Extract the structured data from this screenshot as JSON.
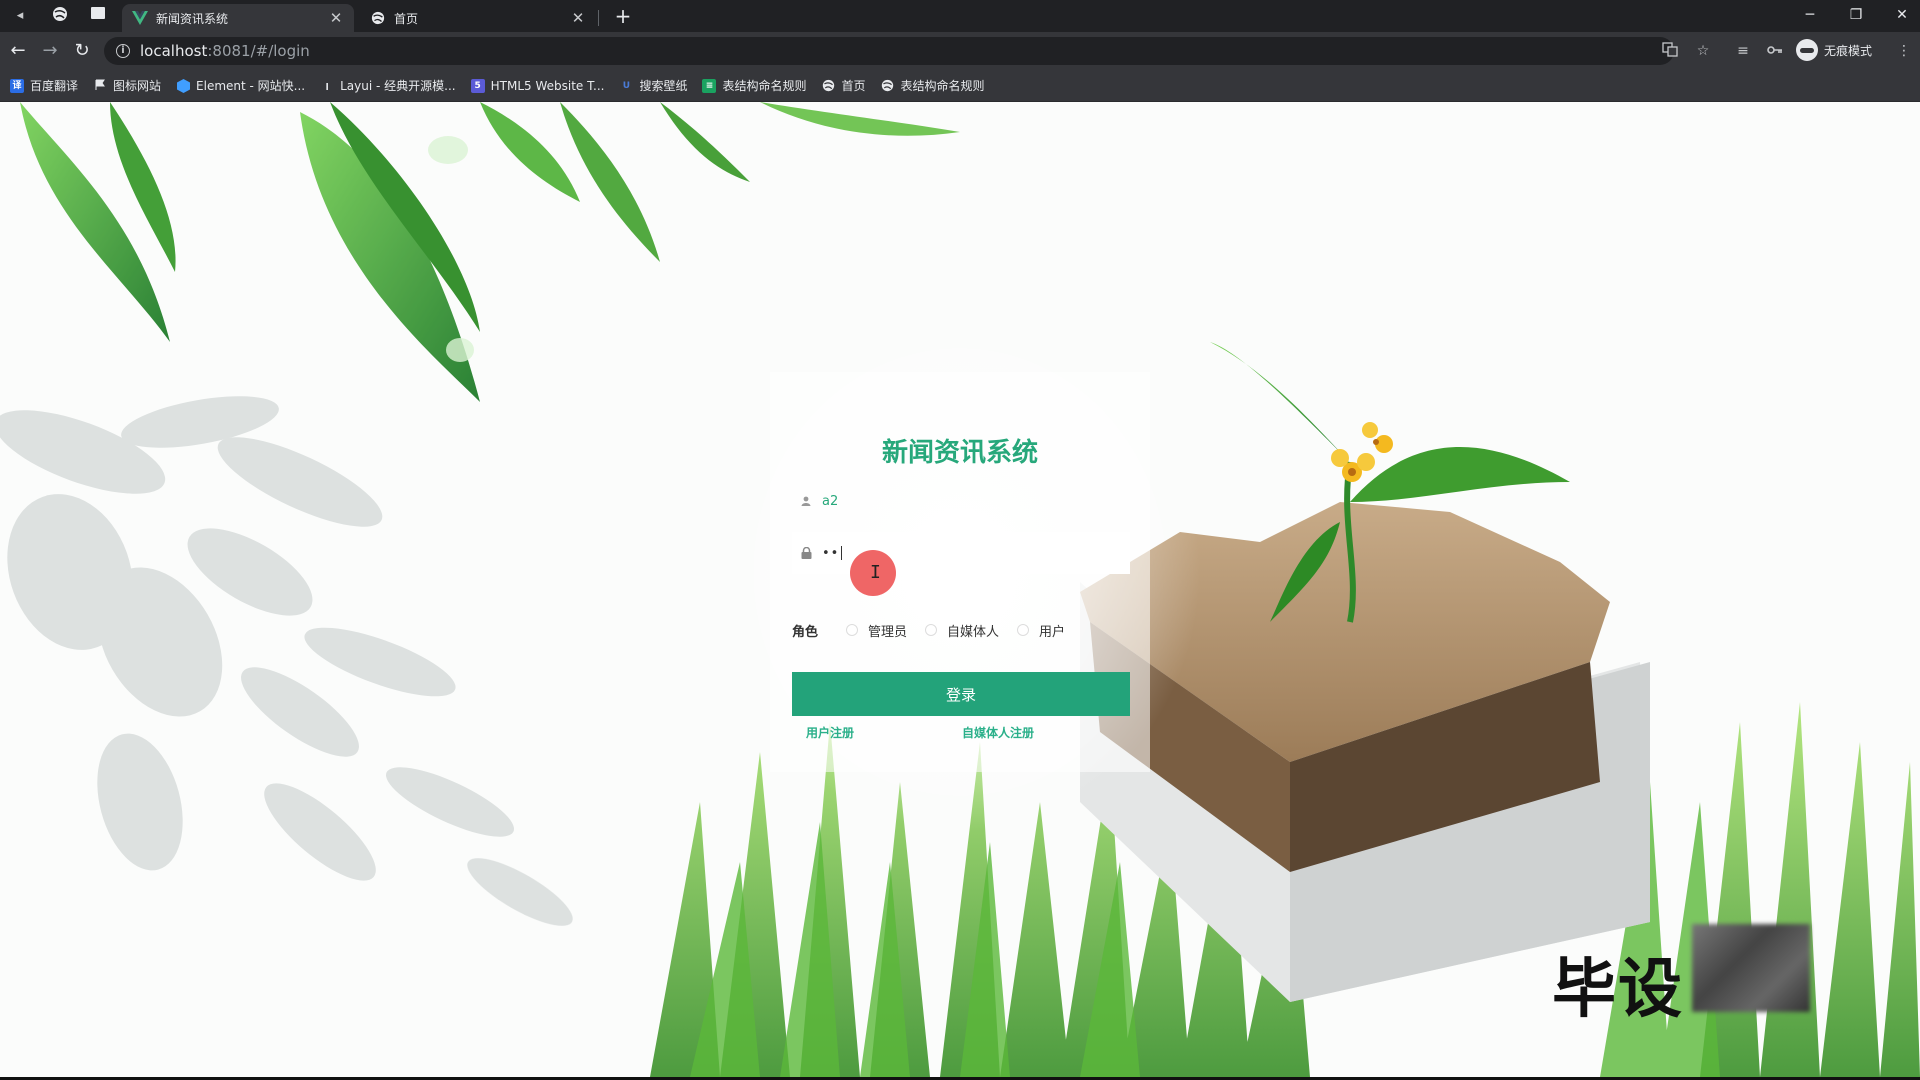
{
  "browser": {
    "tabs": [
      {
        "title": "新闻资讯系统",
        "active": true,
        "favicon": "vue-logo-icon"
      },
      {
        "title": "首页",
        "active": false,
        "favicon": "globe-icon"
      }
    ],
    "address": {
      "host": "localhost",
      "path": ":8081/#/login"
    },
    "profile_label": "无痕模式",
    "bookmarks": [
      {
        "label": "百度翻译",
        "icon": "translate-icon",
        "color": "#2b6de5"
      },
      {
        "label": "图标网站",
        "icon": "flag-icon",
        "color": "#e8eaed"
      },
      {
        "label": "Element - 网站快...",
        "icon": "element-icon",
        "color": "#409eff"
      },
      {
        "label": "Layui - 经典开源模...",
        "icon": "layui-icon",
        "color": "#e8eaed"
      },
      {
        "label": "HTML5 Website T...",
        "icon": "html5-icon",
        "color": "#5b5bd6"
      },
      {
        "label": "搜索壁纸",
        "icon": "wallpaper-icon",
        "color": "#4a7bd6"
      },
      {
        "label": "表结构命名规则",
        "icon": "doc-icon",
        "color": "#1aa260"
      },
      {
        "label": "首页",
        "icon": "globe-icon",
        "color": "#e8eaed"
      },
      {
        "label": "表结构命名规则",
        "icon": "globe-icon",
        "color": "#e8eaed"
      }
    ]
  },
  "login": {
    "title": "新闻资讯系统",
    "username_value": "a2",
    "password_value": "••",
    "role_label": "角色",
    "roles": [
      "管理员",
      "自媒体人",
      "用户"
    ],
    "login_button": "登录",
    "register_user": "用户注册",
    "register_media": "自媒体人注册"
  },
  "watermark_text": "毕设",
  "colors": {
    "accent": "#23a37a",
    "title": "#27a87b",
    "cursor_dot": "#ee5959"
  }
}
